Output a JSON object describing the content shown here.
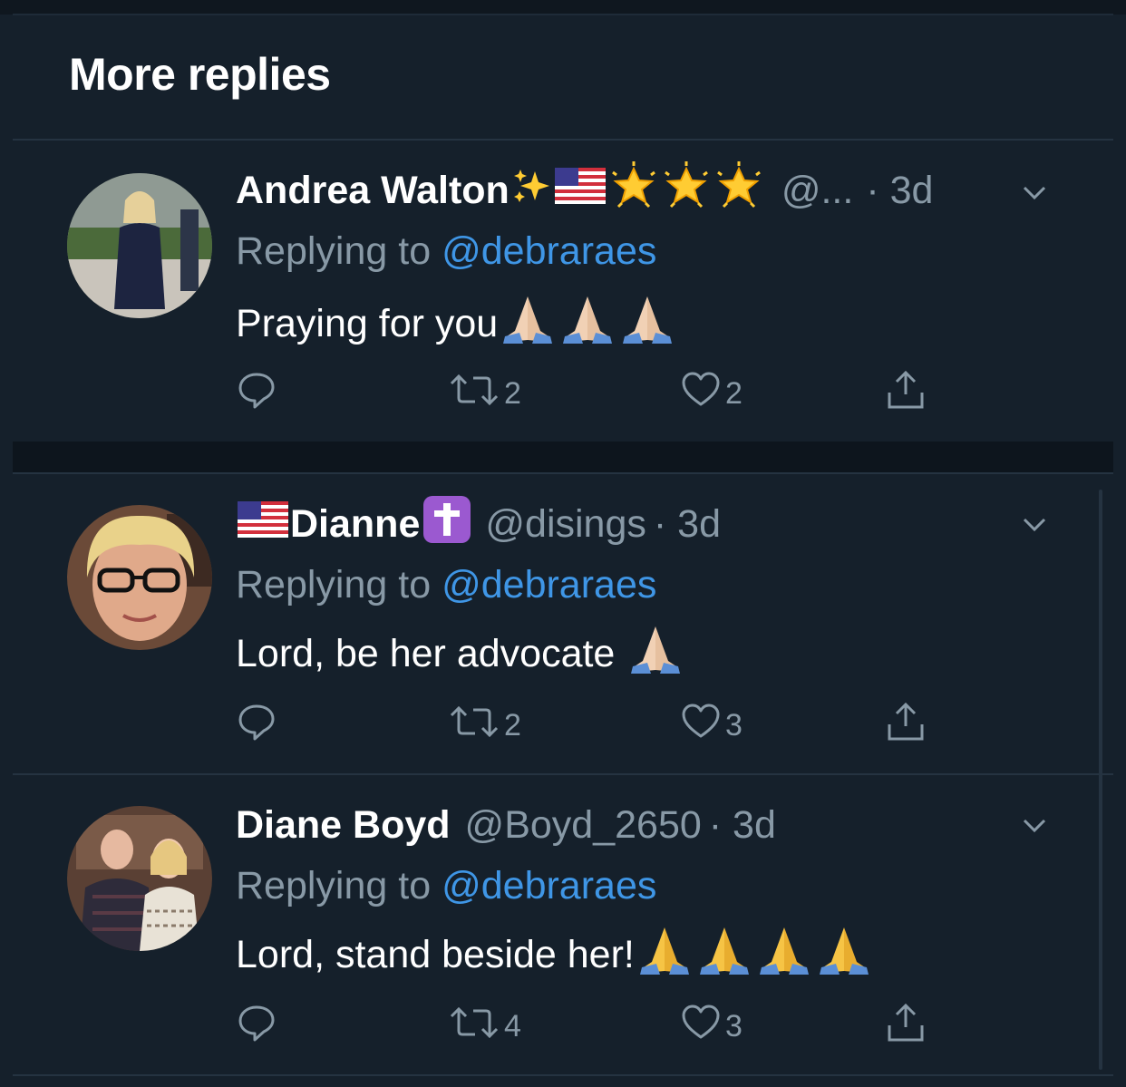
{
  "header": {
    "title": "More replies"
  },
  "tweets": [
    {
      "name": "Andrea Walton",
      "handle": "@...",
      "time": "· 3d",
      "replying_prefix": "Replying to",
      "replying_to": "@debraraes",
      "text": "Praying for you",
      "replies": "",
      "retweets": "2",
      "likes": "2",
      "name_emojis": [
        "sparkles",
        "us-flag",
        "glowing-star",
        "glowing-star",
        "glowing-star"
      ],
      "text_emojis": [
        "folded-hands",
        "folded-hands",
        "folded-hands"
      ]
    },
    {
      "name": "Dianne",
      "handle": "@disings",
      "time": "· 3d",
      "replying_prefix": "Replying to",
      "replying_to": "@debraraes",
      "text": "Lord, be her advocate",
      "replies": "",
      "retweets": "2",
      "likes": "3",
      "name_emojis": [
        "us-flag",
        "latin-cross"
      ],
      "text_emojis": [
        "folded-hands"
      ]
    },
    {
      "name": "Diane Boyd",
      "handle": "@Boyd_2650",
      "time": "· 3d",
      "replying_prefix": "Replying to",
      "replying_to": "@debraraes",
      "text": "Lord, stand beside her!",
      "replies": "",
      "retweets": "4",
      "likes": "3",
      "name_emojis": [],
      "text_emojis": [
        "folded-hands",
        "folded-hands",
        "folded-hands",
        "folded-hands"
      ]
    }
  ],
  "colors": {
    "background": "#15202b",
    "secondary_text": "#8899a6",
    "link": "#3f96e6",
    "divider": "#253341"
  },
  "icons": [
    "reply-icon",
    "retweet-icon",
    "like-icon",
    "share-icon",
    "chevron-down-icon"
  ]
}
